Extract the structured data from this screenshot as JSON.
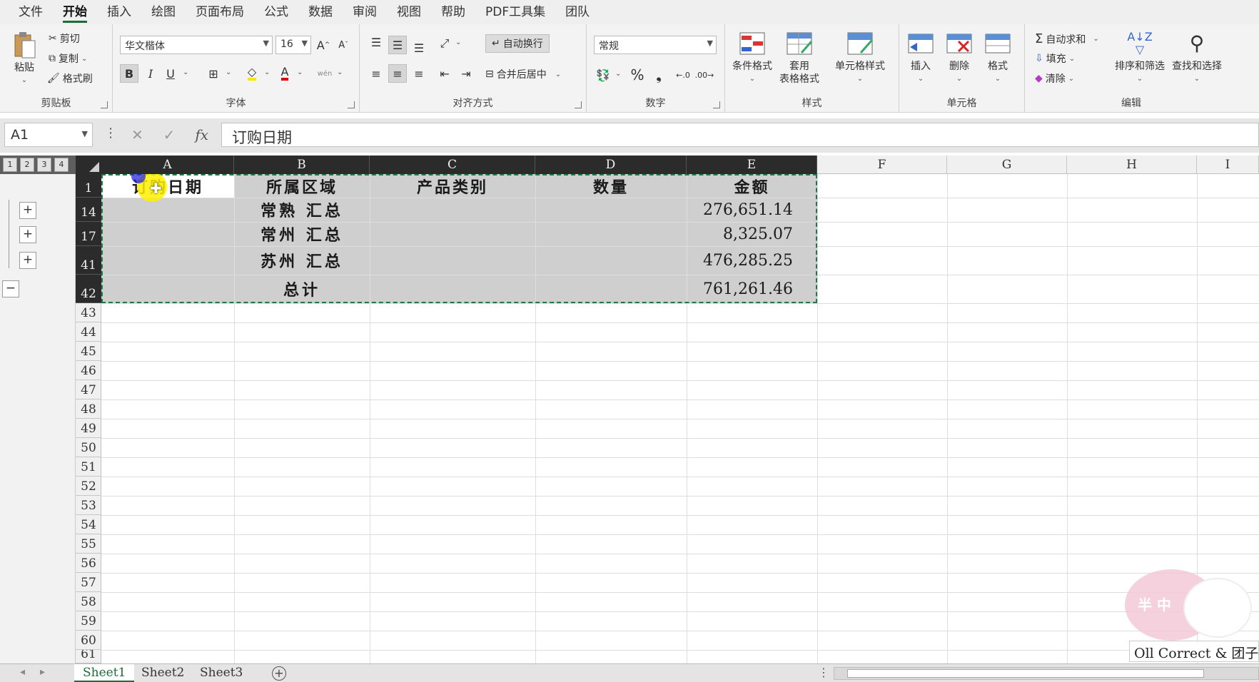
{
  "menu": {
    "items": [
      "文件",
      "开始",
      "插入",
      "绘图",
      "页面布局",
      "公式",
      "数据",
      "审阅",
      "视图",
      "帮助",
      "PDF工具集",
      "团队"
    ],
    "active_index": 1
  },
  "ribbon": {
    "clipboard": {
      "paste": "粘贴",
      "cut": "剪切",
      "copy": "复制",
      "format_painter": "格式刷",
      "label": "剪贴板"
    },
    "font": {
      "name": "华文楷体",
      "size": "16",
      "bold": "B",
      "italic": "I",
      "underline": "U",
      "font_color_letter": "A",
      "phonetic": "wén",
      "label": "字体"
    },
    "alignment": {
      "wrap": "自动换行",
      "merge": "合并后居中",
      "label": "对齐方式"
    },
    "number": {
      "format": "常规",
      "percent": "%",
      "comma": "❟",
      "label": "数字"
    },
    "styles": {
      "conditional": "条件格式",
      "table_1": "套用",
      "table_2": "表格格式",
      "cell_style": "单元格样式",
      "label": "样式"
    },
    "cells": {
      "insert": "插入",
      "delete": "删除",
      "format": "格式",
      "label": "单元格"
    },
    "editing": {
      "autosum": "自动求和",
      "fill": "填充",
      "clear": "清除",
      "sort": "排序和筛选",
      "find": "查找和选择",
      "label": "编辑"
    }
  },
  "formula_bar": {
    "name_box": "A1",
    "fx": "fx",
    "content": "订购日期"
  },
  "outline_levels": [
    "1",
    "2",
    "3",
    "4"
  ],
  "columns": [
    "A",
    "B",
    "C",
    "D",
    "E",
    "F",
    "G",
    "H",
    "I"
  ],
  "rows": [
    "1",
    "14",
    "17",
    "41",
    "42",
    "43",
    "44",
    "45",
    "46",
    "47",
    "48",
    "49",
    "50",
    "51",
    "52",
    "53",
    "54",
    "55",
    "56",
    "57",
    "58",
    "59",
    "60",
    "61"
  ],
  "table": {
    "headers": [
      "订购日期",
      "所属区域",
      "产品类别",
      "数量",
      "金额"
    ],
    "data": [
      {
        "region": "常熟 汇总",
        "amount": "276,651.14"
      },
      {
        "region": "常州 汇总",
        "amount": "8,325.07"
      },
      {
        "region": "苏州 汇总",
        "amount": "476,285.25"
      },
      {
        "region": "总计",
        "amount": "761,261.46"
      }
    ]
  },
  "sheets": [
    "Sheet1",
    "Sheet2",
    "Sheet3"
  ],
  "watermark": {
    "text": "Oll Correct & 团子",
    "badge": "半 中"
  }
}
